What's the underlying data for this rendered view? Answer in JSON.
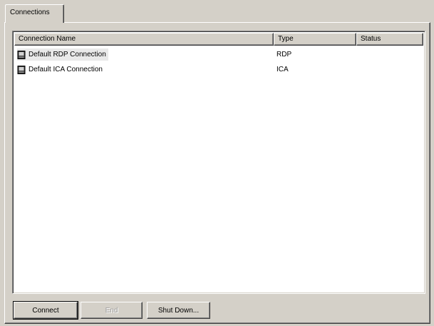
{
  "tabs": [
    {
      "label": "Connections",
      "active": true
    }
  ],
  "list": {
    "columns": [
      {
        "label": "Connection Name"
      },
      {
        "label": "Type"
      },
      {
        "label": "Status"
      }
    ],
    "rows": [
      {
        "name": "Default RDP Connection",
        "type": "RDP",
        "status": "",
        "selected": true,
        "icon": "terminal-computer-icon"
      },
      {
        "name": "Default ICA Connection",
        "type": "ICA",
        "status": "",
        "selected": false,
        "icon": "terminal-computer-icon"
      }
    ]
  },
  "buttons": {
    "connect": {
      "label": "Connect",
      "enabled": true,
      "default": true
    },
    "end": {
      "label": "End",
      "enabled": false
    },
    "shutdown": {
      "label": "Shut Down...",
      "enabled": true
    }
  },
  "colors": {
    "face": "#d4d0c8",
    "list_background": "#ffffff",
    "selection": "#e9e9e9"
  }
}
